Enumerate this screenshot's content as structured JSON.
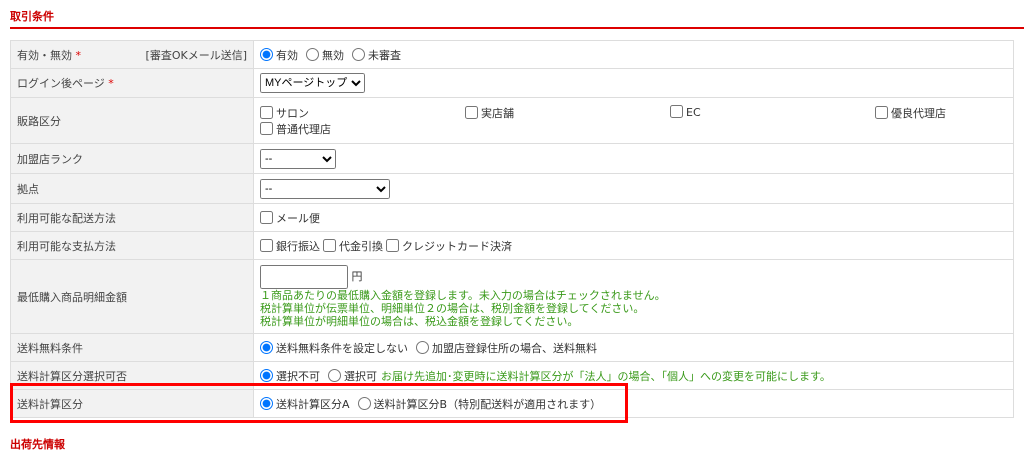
{
  "section_title": "取引条件",
  "next_section_title": "出荷先情報",
  "rows": {
    "active": {
      "label": "有効・無効",
      "required": "*",
      "note": "[審査OKメール送信]",
      "options": [
        "有効",
        "無効",
        "未審査"
      ],
      "selected": "有効"
    },
    "login_page": {
      "label": "ログイン後ページ",
      "required": "*",
      "value": "MYページトップ"
    },
    "channel": {
      "label": "販路区分",
      "options": [
        "サロン",
        "実店舗",
        "EC",
        "優良代理店",
        "普通代理店"
      ]
    },
    "rank": {
      "label": "加盟店ランク",
      "value": "--"
    },
    "base": {
      "label": "拠点",
      "value": "--"
    },
    "shipping": {
      "label": "利用可能な配送方法",
      "options": [
        "メール便"
      ]
    },
    "payment": {
      "label": "利用可能な支払方法",
      "options": [
        "銀行振込",
        "代金引換",
        "クレジットカード決済"
      ]
    },
    "min_amount": {
      "label": "最低購入商品明細金額",
      "value": "",
      "unit": "円",
      "notes": [
        "１商品あたりの最低購入金額を登録します。未入力の場合はチェックされません。",
        "税計算単位が伝票単位、明細単位２の場合は、税別金額を登録してください。",
        "税計算単位が明細単位の場合は、税込金額を登録してください。"
      ]
    },
    "free_shipping": {
      "label": "送料無料条件",
      "options": [
        "送料無料条件を設定しない",
        "加盟店登録住所の場合、送料無料"
      ],
      "selected": "送料無料条件を設定しない"
    },
    "calc_select": {
      "label": "送料計算区分選択可否",
      "options": [
        "選択不可",
        "選択可"
      ],
      "selected": "選択不可",
      "note": "お届け先追加･変更時に送料計算区分が「法人」の場合、「個人」への変更を可能にします。"
    },
    "calc": {
      "label": "送料計算区分",
      "options": [
        "送料計算区分A",
        "送料計算区分B（特別配送料が適用されます）"
      ],
      "selected": "送料計算区分A"
    }
  },
  "colors": {
    "accent": "#dd0000",
    "note": "#3a9a1a",
    "highlight": "#ff0000"
  }
}
